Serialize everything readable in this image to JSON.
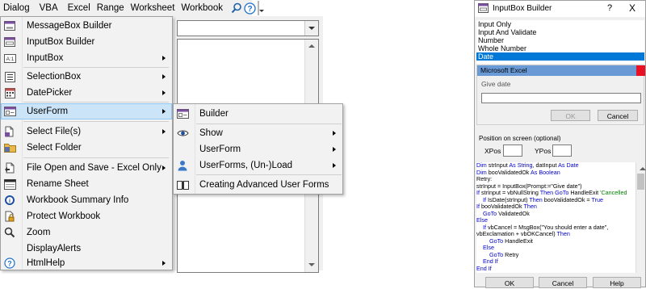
{
  "toolbar": {
    "menus": [
      "Dialog",
      "VBA",
      "Excel",
      "Range",
      "Worksheet",
      "Workbook"
    ],
    "icons": [
      "search-icon",
      "help-icon",
      "toolbar-options-icon"
    ]
  },
  "menu": {
    "items": [
      {
        "label": "MessageBox Builder",
        "icon": "messagebox-icon",
        "submenu": false
      },
      {
        "label": "InputBox Builder",
        "icon": "inputbox-builder-icon",
        "submenu": false
      },
      {
        "label": "InputBox",
        "icon": "inputbox-icon",
        "submenu": true
      },
      {
        "label": "SelectionBox",
        "icon": "selectionbox-icon",
        "submenu": true
      },
      {
        "label": "DatePicker",
        "icon": "calendar-icon",
        "submenu": true
      },
      {
        "label": "UserForm",
        "icon": "userform-icon",
        "submenu": true,
        "selected": true
      },
      {
        "label": "Select File(s)",
        "icon": "select-file-icon",
        "submenu": true
      },
      {
        "label": "Select Folder",
        "icon": "folder-icon",
        "submenu": false
      },
      {
        "label": "File Open and Save - Excel Only",
        "icon": "file-open-save-icon",
        "submenu": true
      },
      {
        "label": "Rename Sheet",
        "icon": "rename-sheet-icon",
        "submenu": false
      },
      {
        "label": "Workbook Summary Info",
        "icon": "info-icon",
        "submenu": false
      },
      {
        "label": "Protect Workbook",
        "icon": "protect-workbook-icon",
        "submenu": false
      },
      {
        "label": "Zoom",
        "icon": "zoom-icon",
        "submenu": false
      },
      {
        "label": "DisplayAlerts",
        "icon": "",
        "submenu": false
      },
      {
        "label": "HtmlHelp",
        "icon": "help-icon",
        "submenu": true
      }
    ]
  },
  "submenu": {
    "items": [
      {
        "label": "Builder",
        "icon": "builder-icon",
        "submenu": false
      },
      {
        "label": "Show",
        "icon": "eye-icon",
        "submenu": true
      },
      {
        "label": "UserForm",
        "icon": "",
        "submenu": true
      },
      {
        "label": "UserForms, (Un-)Load",
        "icon": "user-icon",
        "submenu": true
      },
      {
        "label": "Creating Advanced User Forms",
        "icon": "book-icon",
        "submenu": false
      }
    ]
  },
  "dialog": {
    "title": "InputBox Builder",
    "help_symbol": "?",
    "close_symbol": "X",
    "types": [
      "Input Only",
      "Input And Validate",
      "Number",
      "Whole Number",
      "Date"
    ],
    "selected_type": "Date",
    "preview": {
      "title": "Microsoft Excel",
      "prompt": "Give date",
      "ok_label": "OK",
      "cancel_label": "Cancel"
    },
    "position": {
      "title": "Position on screen (optional)",
      "xpos_label": "XPos",
      "ypos_label": "YPos"
    },
    "code_lines": [
      [
        {
          "t": "Dim",
          "k": "kw"
        },
        {
          "t": " strInput "
        },
        {
          "t": "As String",
          "k": "kw"
        },
        {
          "t": ", datInput "
        },
        {
          "t": "As Date",
          "k": "kw"
        }
      ],
      [
        {
          "t": "Dim",
          "k": "kw"
        },
        {
          "t": " booValidatedOk "
        },
        {
          "t": "As Boolean",
          "k": "kw"
        }
      ],
      [
        {
          "t": "Retry:"
        }
      ],
      [
        {
          "t": "strInput = InputBox(Prompt:=\"Give date\")"
        }
      ],
      [
        {
          "t": "If",
          "k": "kw"
        },
        {
          "t": " strInput = vbNullString "
        },
        {
          "t": "Then GoTo",
          "k": "kw"
        },
        {
          "t": " HandleExit "
        },
        {
          "t": "'Cancelled",
          "k": "cm"
        }
      ],
      [
        {
          "t": "    "
        },
        {
          "t": "If",
          "k": "kw"
        },
        {
          "t": " IsDate(strInput) "
        },
        {
          "t": "Then",
          "k": "kw"
        },
        {
          "t": " booValidatedOk = "
        },
        {
          "t": "True",
          "k": "kw"
        }
      ],
      [
        {
          "t": "If",
          "k": "kw"
        },
        {
          "t": " booValidatedOk "
        },
        {
          "t": "Then",
          "k": "kw"
        }
      ],
      [
        {
          "t": "    "
        },
        {
          "t": "GoTo",
          "k": "kw"
        },
        {
          "t": " ValidatedOk"
        }
      ],
      [
        {
          "t": "Else",
          "k": "kw"
        }
      ],
      [
        {
          "t": "    "
        },
        {
          "t": "If",
          "k": "kw"
        },
        {
          "t": " vbCancel = MsgBox(\"You should enter a date\","
        }
      ],
      [
        {
          "t": "vbExclamation + vbOKCancel) "
        },
        {
          "t": "Then",
          "k": "kw"
        }
      ],
      [
        {
          "t": "        "
        },
        {
          "t": "GoTo",
          "k": "kw"
        },
        {
          "t": " HandleExit"
        }
      ],
      [
        {
          "t": "    "
        },
        {
          "t": "Else",
          "k": "kw"
        }
      ],
      [
        {
          "t": "        "
        },
        {
          "t": "GoTo",
          "k": "kw"
        },
        {
          "t": " Retry"
        }
      ],
      [
        {
          "t": "    "
        },
        {
          "t": "End If",
          "k": "kw"
        }
      ],
      [
        {
          "t": "End If",
          "k": "kw"
        }
      ]
    ],
    "buttons": {
      "ok": "OK",
      "cancel": "Cancel",
      "help": "Help"
    }
  },
  "colors": {
    "accent": "#0078d7",
    "menu_highlight": "#cce4f7",
    "vba_keyword": "#0000c8",
    "vba_comment": "#008000",
    "close_red": "#e81123"
  }
}
